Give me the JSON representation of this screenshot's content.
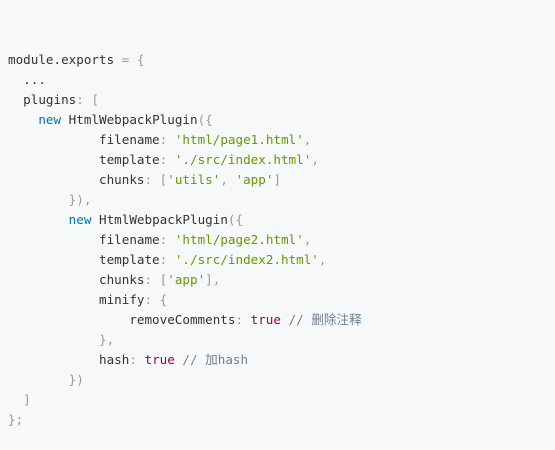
{
  "colors": {
    "background": "#f6f8fa",
    "plain": "#333333",
    "punctuation": "#999999",
    "keyword": "#0077aa",
    "string": "#669900",
    "boolean": "#990055",
    "comment": "#708090"
  },
  "code": {
    "lines": [
      [
        {
          "t": "module.exports",
          "k": "plain"
        },
        {
          "t": " = ",
          "k": "punct"
        },
        {
          "t": "{",
          "k": "punct"
        }
      ],
      [
        {
          "t": "  ...",
          "k": "plain"
        }
      ],
      [
        {
          "t": "  plugins",
          "k": "key"
        },
        {
          "t": ": ",
          "k": "punct"
        },
        {
          "t": "[",
          "k": "punct"
        }
      ],
      [
        {
          "t": "    ",
          "k": "plain"
        },
        {
          "t": "new",
          "k": "keyword"
        },
        {
          "t": " HtmlWebpackPlugin",
          "k": "class"
        },
        {
          "t": "({",
          "k": "punct"
        }
      ],
      [
        {
          "t": "            filename",
          "k": "key"
        },
        {
          "t": ": ",
          "k": "punct"
        },
        {
          "t": "'html/page1.html'",
          "k": "string"
        },
        {
          "t": ",",
          "k": "punct"
        }
      ],
      [
        {
          "t": "            template",
          "k": "key"
        },
        {
          "t": ": ",
          "k": "punct"
        },
        {
          "t": "'./src/index.html'",
          "k": "string"
        },
        {
          "t": ",",
          "k": "punct"
        }
      ],
      [
        {
          "t": "            chunks",
          "k": "key"
        },
        {
          "t": ": ",
          "k": "punct"
        },
        {
          "t": "[",
          "k": "punct"
        },
        {
          "t": "'utils'",
          "k": "string"
        },
        {
          "t": ", ",
          "k": "punct"
        },
        {
          "t": "'app'",
          "k": "string"
        },
        {
          "t": "]",
          "k": "punct"
        }
      ],
      [
        {
          "t": "        })",
          "k": "punct"
        },
        {
          "t": ",",
          "k": "punct"
        }
      ],
      [
        {
          "t": "        ",
          "k": "plain"
        },
        {
          "t": "new",
          "k": "keyword"
        },
        {
          "t": " HtmlWebpackPlugin",
          "k": "class"
        },
        {
          "t": "({",
          "k": "punct"
        }
      ],
      [
        {
          "t": "            filename",
          "k": "key"
        },
        {
          "t": ": ",
          "k": "punct"
        },
        {
          "t": "'html/page2.html'",
          "k": "string"
        },
        {
          "t": ",",
          "k": "punct"
        }
      ],
      [
        {
          "t": "            template",
          "k": "key"
        },
        {
          "t": ": ",
          "k": "punct"
        },
        {
          "t": "'./src/index2.html'",
          "k": "string"
        },
        {
          "t": ",",
          "k": "punct"
        }
      ],
      [
        {
          "t": "            chunks",
          "k": "key"
        },
        {
          "t": ": ",
          "k": "punct"
        },
        {
          "t": "[",
          "k": "punct"
        },
        {
          "t": "'app'",
          "k": "string"
        },
        {
          "t": "]",
          "k": "punct"
        },
        {
          "t": ",",
          "k": "punct"
        }
      ],
      [
        {
          "t": "            minify",
          "k": "key"
        },
        {
          "t": ": ",
          "k": "punct"
        },
        {
          "t": "{",
          "k": "punct"
        }
      ],
      [
        {
          "t": "                removeComments",
          "k": "key"
        },
        {
          "t": ": ",
          "k": "punct"
        },
        {
          "t": "true",
          "k": "bool"
        },
        {
          "t": " // 删除注释",
          "k": "comment"
        }
      ],
      [
        {
          "t": "            }",
          "k": "punct"
        },
        {
          "t": ",",
          "k": "punct"
        }
      ],
      [
        {
          "t": "            hash",
          "k": "key"
        },
        {
          "t": ": ",
          "k": "punct"
        },
        {
          "t": "true",
          "k": "bool"
        },
        {
          "t": " // 加hash",
          "k": "comment"
        }
      ],
      [
        {
          "t": "        })",
          "k": "punct"
        }
      ],
      [
        {
          "t": "  ]",
          "k": "punct"
        }
      ],
      [
        {
          "t": "}",
          "k": "punct"
        },
        {
          "t": ";",
          "k": "punct"
        }
      ]
    ]
  }
}
